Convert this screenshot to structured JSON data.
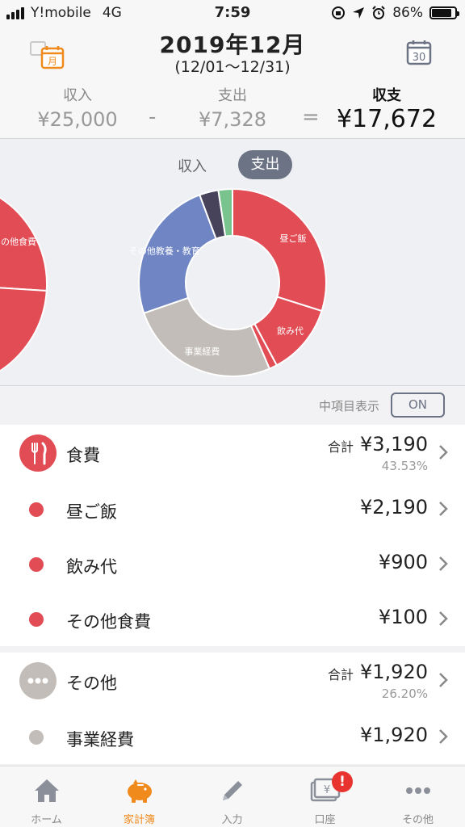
{
  "status_bar": {
    "carrier": "Y!mobile",
    "network": "4G",
    "time": "7:59",
    "battery": "86%",
    "battery_level": 0.86
  },
  "header": {
    "title": "2019年12月",
    "range": "(12/01〜12/31)",
    "calendar_left_label": "月",
    "calendar_right_label": "30",
    "income_label": "収入",
    "income_value": "¥25,000",
    "minus": "-",
    "expense_label": "支出",
    "expense_value": "¥7,328",
    "equals": "=",
    "balance_label": "収支",
    "balance_value": "¥17,672"
  },
  "segment": {
    "income": "収入",
    "expense": "支出",
    "selected": "支出"
  },
  "chart_data": {
    "type": "pie",
    "style": "donut",
    "slices": [
      {
        "label": "昼ご飯",
        "value": 2190,
        "color": "#e14c55"
      },
      {
        "label": "飲み代",
        "value": 900,
        "color": "#e14c55"
      },
      {
        "label": "その他食費",
        "value": 100,
        "color": "#e14c55"
      },
      {
        "label": "事業経費",
        "value": 1920,
        "color": "#c2bdb8"
      },
      {
        "label": "その他教養・教育",
        "value": 1800,
        "color": "#6f85c4"
      },
      {
        "label": "",
        "value": 240,
        "color": "#46435a"
      },
      {
        "label": "",
        "value": 178,
        "color": "#79c48e"
      }
    ],
    "left_partial_label": "その他食費"
  },
  "options": {
    "label": "中項目表示",
    "toggle": "ON"
  },
  "categories": [
    {
      "name": "食費",
      "total_label": "合計",
      "total": "¥3,190",
      "percent": "43.53%",
      "color": "#e14c55",
      "icon": "fork-knife-icon",
      "items": [
        {
          "name": "昼ご飯",
          "amount": "¥2,190",
          "color": "#e14c55"
        },
        {
          "name": "飲み代",
          "amount": "¥900",
          "color": "#e14c55"
        },
        {
          "name": "その他食費",
          "amount": "¥100",
          "color": "#e14c55"
        }
      ]
    },
    {
      "name": "その他",
      "total_label": "合計",
      "total": "¥1,920",
      "percent": "26.20%",
      "color": "#c2bdb8",
      "icon": "more-dots-icon",
      "items": [
        {
          "name": "事業経費",
          "amount": "¥1,920",
          "color": "#c2bdb8"
        }
      ]
    }
  ],
  "tabbar": {
    "tabs": [
      {
        "label": "ホーム",
        "icon": "home-icon"
      },
      {
        "label": "家計簿",
        "icon": "piggy-bank-icon",
        "active": true
      },
      {
        "label": "入力",
        "icon": "pencil-icon"
      },
      {
        "label": "口座",
        "icon": "wallet-icon",
        "badge": "!"
      },
      {
        "label": "その他",
        "icon": "more-dots-icon"
      }
    ]
  }
}
